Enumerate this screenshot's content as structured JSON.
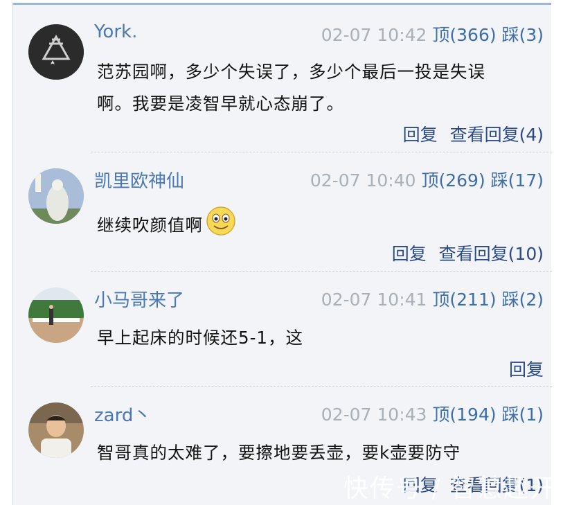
{
  "comments": [
    {
      "username": "York.",
      "time": "02-07 10:42",
      "up_label": "顶(366)",
      "down_label": "踩(3)",
      "content_line1": "范苏园啊，多少个失误了，多少个最后一投是失误",
      "content_line2": "啊。我要是凌智早就心态崩了。",
      "reply_label": "回复",
      "view_replies_label": "查看回复(4)"
    },
    {
      "username": "凯里欧神仙",
      "time": "02-07 10:40",
      "up_label": "顶(269)",
      "down_label": "踩(17)",
      "content_line1": "继续吹颜值啊",
      "reply_label": "回复",
      "view_replies_label": "查看回复(10)"
    },
    {
      "username": "小马哥来了",
      "time": "02-07 10:41",
      "up_label": "顶(211)",
      "down_label": "踩(2)",
      "content_line1": "早上起床的时候还5-1，这",
      "reply_label": "回复"
    },
    {
      "username": "zard丶",
      "time": "02-07 10:43",
      "up_label": "顶(194)",
      "down_label": "踩(1)",
      "content_line1": "智哥真的太难了，要擦地要丢壶，要k壶要防守",
      "reply_label": "回复",
      "view_replies_label": "查看回复(1)"
    }
  ],
  "watermark": "快传号 / 智慧趣开",
  "colors": {
    "username": "#4a78b5",
    "action": "#2b4a8c",
    "meta": "#a9b0b8"
  }
}
